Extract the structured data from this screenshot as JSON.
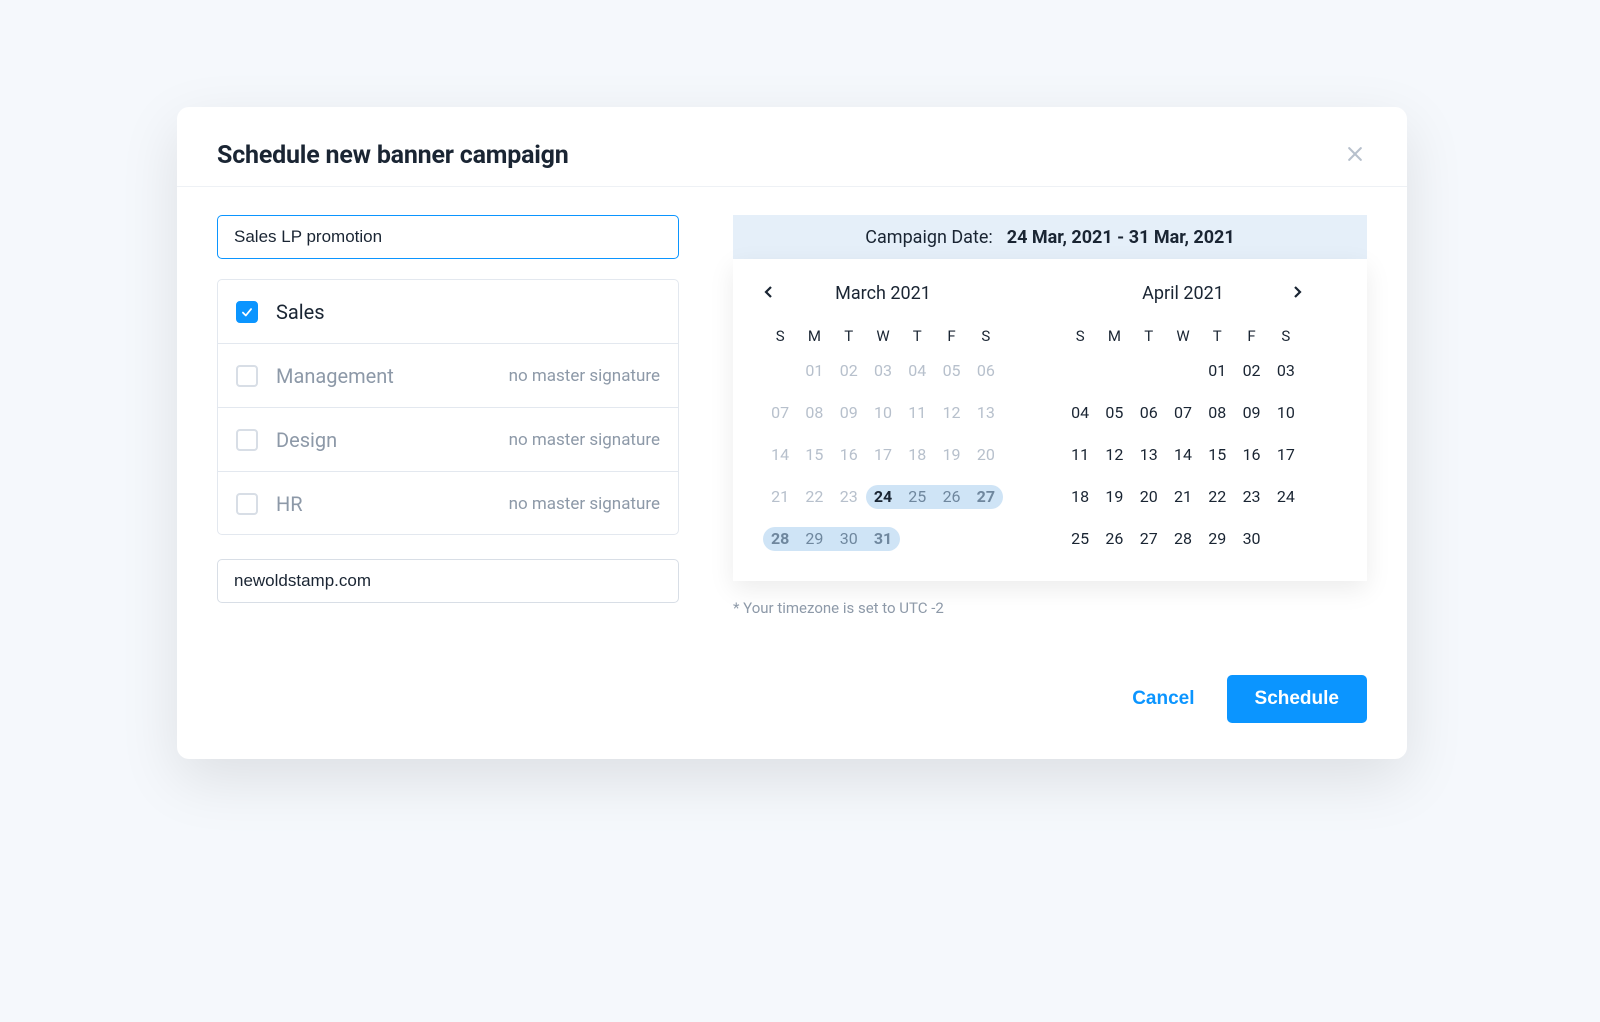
{
  "modal": {
    "title": "Schedule new banner campaign",
    "campaign_name": "Sales LP promotion",
    "link_value": "newoldstamp.com",
    "departments": [
      {
        "name": "Sales",
        "checked": true,
        "note": ""
      },
      {
        "name": "Management",
        "checked": false,
        "note": "no master signature"
      },
      {
        "name": "Design",
        "checked": false,
        "note": "no master signature"
      },
      {
        "name": "HR",
        "checked": false,
        "note": "no master signature"
      }
    ],
    "date_header": {
      "label": "Campaign Date:",
      "value": "24 Mar, 2021 - 31 Mar, 2021"
    },
    "weekdays": [
      "S",
      "M",
      "T",
      "W",
      "T",
      "F",
      "S"
    ],
    "months": [
      {
        "title": "March 2021",
        "has_prev": true,
        "has_next": false,
        "days": [
          {
            "n": "",
            "cls": "empty"
          },
          {
            "n": "01",
            "cls": "muted"
          },
          {
            "n": "02",
            "cls": "muted"
          },
          {
            "n": "03",
            "cls": "muted"
          },
          {
            "n": "04",
            "cls": "muted"
          },
          {
            "n": "05",
            "cls": "muted"
          },
          {
            "n": "06",
            "cls": "muted"
          },
          {
            "n": "07",
            "cls": "muted"
          },
          {
            "n": "08",
            "cls": "muted"
          },
          {
            "n": "09",
            "cls": "muted"
          },
          {
            "n": "10",
            "cls": "muted"
          },
          {
            "n": "11",
            "cls": "muted"
          },
          {
            "n": "12",
            "cls": "muted"
          },
          {
            "n": "13",
            "cls": "muted"
          },
          {
            "n": "14",
            "cls": "muted"
          },
          {
            "n": "15",
            "cls": "muted"
          },
          {
            "n": "16",
            "cls": "muted"
          },
          {
            "n": "17",
            "cls": "muted"
          },
          {
            "n": "18",
            "cls": "muted"
          },
          {
            "n": "19",
            "cls": "muted"
          },
          {
            "n": "20",
            "cls": "muted"
          },
          {
            "n": "21",
            "cls": "muted"
          },
          {
            "n": "22",
            "cls": "muted"
          },
          {
            "n": "23",
            "cls": "muted"
          },
          {
            "n": "24",
            "cls": "range-start"
          },
          {
            "n": "25",
            "cls": "in-range dim"
          },
          {
            "n": "26",
            "cls": "in-range dim"
          },
          {
            "n": "27",
            "cls": "in-range range-end dim"
          },
          {
            "n": "28",
            "cls": "in-range range-start dim"
          },
          {
            "n": "29",
            "cls": "in-range dim"
          },
          {
            "n": "30",
            "cls": "in-range dim"
          },
          {
            "n": "31",
            "cls": "in-range range-end dim"
          },
          {
            "n": "",
            "cls": "empty"
          },
          {
            "n": "",
            "cls": "empty"
          },
          {
            "n": "",
            "cls": "empty"
          }
        ]
      },
      {
        "title": "April 2021",
        "has_prev": false,
        "has_next": true,
        "days": [
          {
            "n": "",
            "cls": "empty"
          },
          {
            "n": "",
            "cls": "empty"
          },
          {
            "n": "",
            "cls": "empty"
          },
          {
            "n": "",
            "cls": "empty"
          },
          {
            "n": "01",
            "cls": ""
          },
          {
            "n": "02",
            "cls": ""
          },
          {
            "n": "03",
            "cls": ""
          },
          {
            "n": "04",
            "cls": ""
          },
          {
            "n": "05",
            "cls": ""
          },
          {
            "n": "06",
            "cls": ""
          },
          {
            "n": "07",
            "cls": ""
          },
          {
            "n": "08",
            "cls": ""
          },
          {
            "n": "09",
            "cls": ""
          },
          {
            "n": "10",
            "cls": ""
          },
          {
            "n": "11",
            "cls": ""
          },
          {
            "n": "12",
            "cls": ""
          },
          {
            "n": "13",
            "cls": ""
          },
          {
            "n": "14",
            "cls": ""
          },
          {
            "n": "15",
            "cls": ""
          },
          {
            "n": "16",
            "cls": ""
          },
          {
            "n": "17",
            "cls": ""
          },
          {
            "n": "18",
            "cls": ""
          },
          {
            "n": "19",
            "cls": ""
          },
          {
            "n": "20",
            "cls": ""
          },
          {
            "n": "21",
            "cls": ""
          },
          {
            "n": "22",
            "cls": ""
          },
          {
            "n": "23",
            "cls": ""
          },
          {
            "n": "24",
            "cls": ""
          },
          {
            "n": "25",
            "cls": ""
          },
          {
            "n": "26",
            "cls": ""
          },
          {
            "n": "27",
            "cls": ""
          },
          {
            "n": "28",
            "cls": ""
          },
          {
            "n": "29",
            "cls": ""
          },
          {
            "n": "30",
            "cls": ""
          },
          {
            "n": "",
            "cls": "empty"
          }
        ]
      }
    ],
    "timezone_note": "* Your timezone is set to UTC -2",
    "buttons": {
      "cancel": "Cancel",
      "schedule": "Schedule"
    }
  }
}
